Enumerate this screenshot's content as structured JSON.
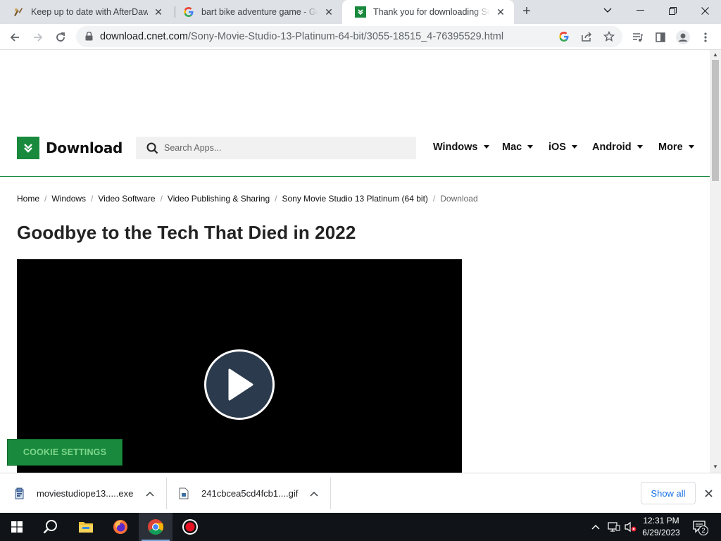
{
  "browser": {
    "tabs": [
      {
        "title": "Keep up to date with AfterDawn!",
        "icon": "afterdawn-favicon",
        "active": false
      },
      {
        "title": "bart bike adventure game - Goog",
        "icon": "google-favicon",
        "active": false
      },
      {
        "title": "Thank you for downloading Sony",
        "icon": "cnet-download-favicon",
        "active": true
      }
    ],
    "address": {
      "domain": "download.cnet.com",
      "path": "/Sony-Movie-Studio-13-Platinum-64-bit/3055-18515_4-76395529.html"
    }
  },
  "site": {
    "logo_text": "Download",
    "search_placeholder": "Search Apps...",
    "nav": [
      "Windows",
      "Mac",
      "iOS",
      "Android",
      "More"
    ],
    "breadcrumb": [
      "Home",
      "Windows",
      "Video Software",
      "Video Publishing & Sharing",
      "Sony Movie Studio 13 Platinum (64 bit)",
      "Download"
    ],
    "headline": "Goodbye to the Tech That Died in 2022",
    "cookie_button": "COOKIE SETTINGS"
  },
  "downloads": {
    "items": [
      {
        "name": "moviestudiope13.....exe",
        "icon": "installer-icon"
      },
      {
        "name": "241cbcea5cd4fcb1....gif",
        "icon": "file-icon"
      }
    ],
    "show_all": "Show all"
  },
  "taskbar": {
    "time": "12:31 PM",
    "date": "6/29/2023",
    "notifications": "2"
  },
  "colors": {
    "brand_green": "#198a3d",
    "tabstrip": "#dee1e6",
    "taskbar": "#101418",
    "link_blue": "#1a73e8"
  }
}
